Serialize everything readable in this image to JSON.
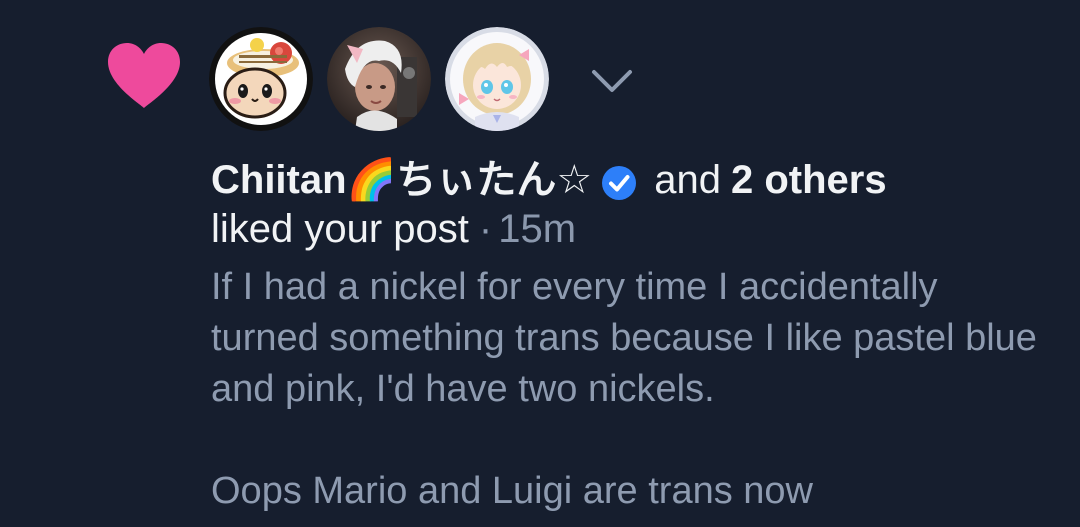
{
  "notification": {
    "icon": "heart-icon",
    "icon_color": "#ee4a9c",
    "avatars": [
      {
        "name": "avatar-chiitan",
        "icon": "chiitan-avatar-icon"
      },
      {
        "name": "avatar-user-2",
        "icon": "white-haired-person-avatar-icon"
      },
      {
        "name": "avatar-user-3",
        "icon": "anime-girl-avatar-icon"
      }
    ],
    "expand_icon": "chevron-down-icon",
    "author_name": "Chiitan🌈ちぃたん☆",
    "verified_icon": "verified-check-icon",
    "verified_color": "#2d7ff9",
    "and_text": "and",
    "others_text": "2 others",
    "action_text": "liked your post",
    "separator": "·",
    "timestamp": "15m",
    "post_text": "If I had a nickel for every time I accidentally turned something trans because I like pastel blue and pink, I'd have two nickels.\n\nOops Mario and Luigi are trans now"
  },
  "colors": {
    "background": "#161e2e",
    "primary_text": "#f1f3f5",
    "secondary_text": "#8e9bb0"
  }
}
